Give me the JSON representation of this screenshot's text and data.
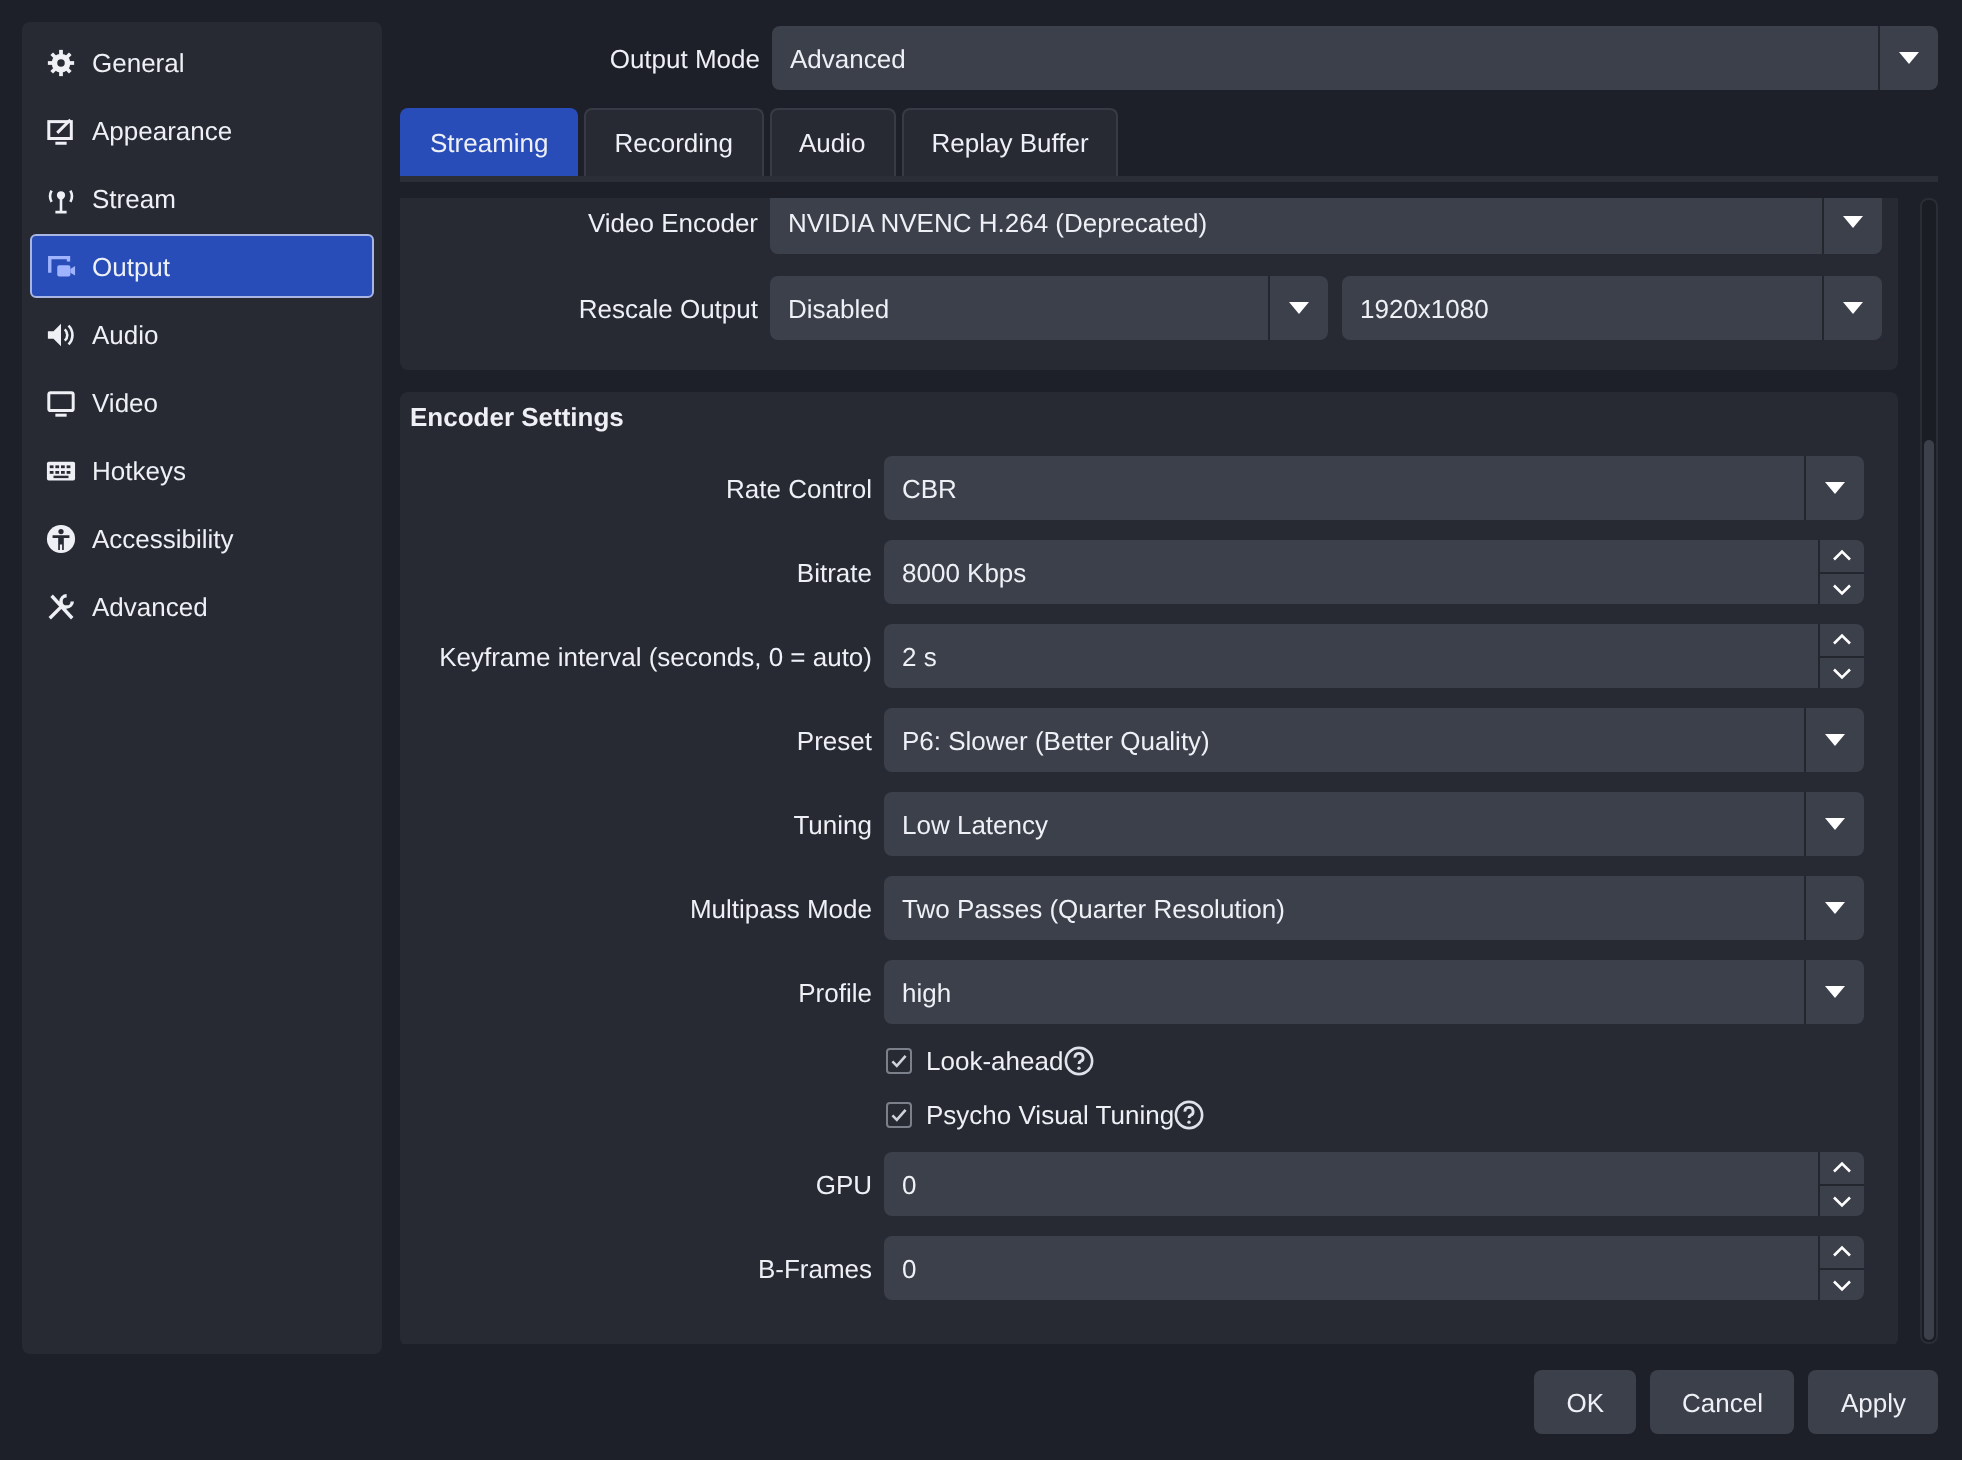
{
  "sidebar": {
    "items": [
      {
        "label": "General",
        "selected": false
      },
      {
        "label": "Appearance",
        "selected": false
      },
      {
        "label": "Stream",
        "selected": false
      },
      {
        "label": "Output",
        "selected": true
      },
      {
        "label": "Audio",
        "selected": false
      },
      {
        "label": "Video",
        "selected": false
      },
      {
        "label": "Hotkeys",
        "selected": false
      },
      {
        "label": "Accessibility",
        "selected": false
      },
      {
        "label": "Advanced",
        "selected": false
      }
    ]
  },
  "output_mode": {
    "label": "Output Mode",
    "value": "Advanced"
  },
  "tabs": [
    {
      "label": "Streaming",
      "selected": true
    },
    {
      "label": "Recording",
      "selected": false
    },
    {
      "label": "Audio",
      "selected": false
    },
    {
      "label": "Replay Buffer",
      "selected": false
    }
  ],
  "general_group": {
    "video_encoder": {
      "label": "Video Encoder",
      "value": "NVIDIA NVENC H.264 (Deprecated)"
    },
    "rescale_output": {
      "label": "Rescale Output",
      "value": "Disabled",
      "resolution": "1920x1080"
    }
  },
  "encoder_settings": {
    "title": "Encoder Settings",
    "rows": [
      {
        "kind": "combo",
        "label": "Rate Control",
        "value": "CBR"
      },
      {
        "kind": "spin",
        "label": "Bitrate",
        "value": "8000 Kbps"
      },
      {
        "kind": "spin",
        "label": "Keyframe interval (seconds, 0 = auto)",
        "value": "2 s"
      },
      {
        "kind": "combo",
        "label": "Preset",
        "value": "P6: Slower (Better Quality)"
      },
      {
        "kind": "combo",
        "label": "Tuning",
        "value": "Low Latency"
      },
      {
        "kind": "combo",
        "label": "Multipass Mode",
        "value": "Two Passes (Quarter Resolution)"
      },
      {
        "kind": "combo",
        "label": "Profile",
        "value": "high"
      },
      {
        "kind": "checkbox",
        "label": "Look-ahead",
        "checked": true
      },
      {
        "kind": "checkbox",
        "label": "Psycho Visual Tuning",
        "checked": true
      },
      {
        "kind": "spin",
        "label": "GPU",
        "value": "0"
      },
      {
        "kind": "spin",
        "label": "B-Frames",
        "value": "0"
      }
    ]
  },
  "buttons": [
    "OK",
    "Cancel",
    "Apply"
  ]
}
